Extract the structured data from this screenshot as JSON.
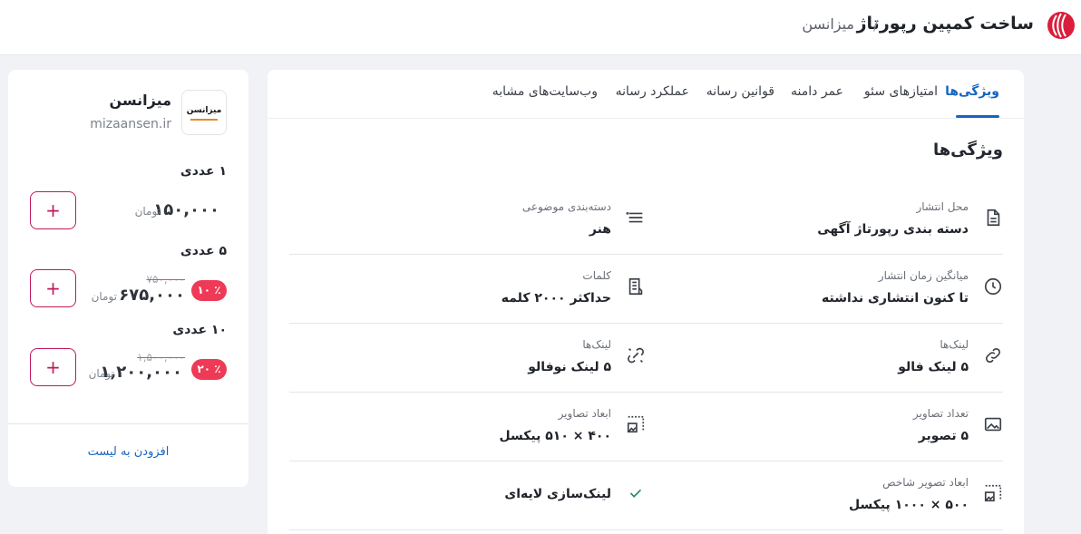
{
  "header": {
    "title": "ساخت کمپین رپورتاژ",
    "separator": "/",
    "media_name": "میزانسن"
  },
  "tabs": [
    {
      "label": "ویژگی‌ها",
      "active": true
    },
    {
      "label": "امتیازهای سئو",
      "active": false
    },
    {
      "label": "عمر دامنه",
      "active": false
    },
    {
      "label": "قوانین رسانه",
      "active": false
    },
    {
      "label": "عملکرد رسانه",
      "active": false
    },
    {
      "label": "وب‌سایت‌های مشابه",
      "active": false
    }
  ],
  "section_title": "ویژگی‌ها",
  "features": {
    "publish_place": {
      "label": "محل انتشار",
      "value": "دسته بندی رپورتاژ آگهی",
      "icon": "document-icon"
    },
    "category": {
      "label": "دسته‌بندی موضوعی",
      "value": "هنر",
      "icon": "list-icon"
    },
    "avg_publish_time": {
      "label": "میانگین زمان انتشار",
      "value": "تا کنون انتشاری نداشته",
      "icon": "clock-icon"
    },
    "words": {
      "label": "کلمات",
      "value": "حداکثر ۲۰۰۰ کلمه",
      "icon": "text-document-icon"
    },
    "links_follow": {
      "label": "لینک‌ها",
      "value": "۵ لینک فالو",
      "icon": "link-icon"
    },
    "links_nofollow": {
      "label": "لینک‌ها",
      "value": "۵ لینک نوفالو",
      "icon": "broken-link-icon"
    },
    "image_count": {
      "label": "تعداد تصاویر",
      "value": "۵ تصویر",
      "icon": "image-icon"
    },
    "image_size": {
      "label": "ابعاد تصاویر",
      "value": "۴۰۰ × ۵۱۰ پیکسل",
      "icon": "image-dimension-icon"
    },
    "featured_size": {
      "label": "ابعاد تصویر شاخص",
      "value": "۵۰۰ × ۱۰۰۰ پیکسل",
      "icon": "image-dimension-icon"
    },
    "layered_link": {
      "value": "لینک‌سازی لایه‌ای",
      "icon": "check-icon"
    }
  },
  "media": {
    "name": "میزانسن",
    "site": "mizaansen.ir",
    "logo_text": "میزانسن"
  },
  "packages": [
    {
      "title": "۱ عددی",
      "price": "۱۵۰,۰۰۰",
      "currency": "تومان",
      "add": "+"
    },
    {
      "title": "۵ عددی",
      "price": "۶۷۵,۰۰۰",
      "currency": "تومان",
      "old_price": "۷۵۰,۰۰۰",
      "discount": "٪ ۱۰",
      "add": "+"
    },
    {
      "title": "۱۰ عددی",
      "price": "۱,۲۰۰,۰۰۰",
      "currency": "تومان",
      "old_price": "۱,۵۰۰,۰۰۰",
      "discount": "٪ ۲۰",
      "add": "+"
    }
  ],
  "add_to_list": "افزودن به لیست",
  "colors": {
    "accent": "#1565c0",
    "logo_red": "#d81e3c",
    "badge": "#ee3a56",
    "button_border": "#c2185b"
  }
}
